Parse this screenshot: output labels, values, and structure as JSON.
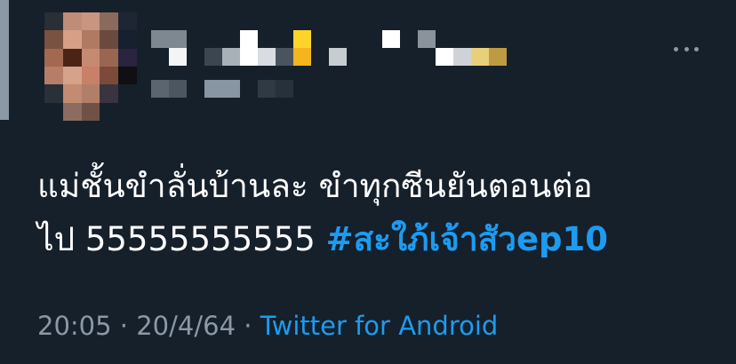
{
  "tweet": {
    "author_name": "",
    "author_handle": "",
    "text_line1": "แม่ชั้นขำลั่นบ้านละ ขำทุกซีนยันตอนต่อ",
    "text_line2": "ไป 55555555555",
    "hashtag": "#สะใภ้เจ้าสัวep10",
    "time": "20:05",
    "separator": "·",
    "date": "20/4/64",
    "source": "Twitter for Android"
  },
  "icons": {
    "more": "more-horizontal-icon",
    "avatar": "blurred-avatar"
  },
  "colors": {
    "background": "#15202b",
    "text": "#ffffff",
    "accent": "#1d9bf0",
    "muted": "#8b98a5"
  }
}
